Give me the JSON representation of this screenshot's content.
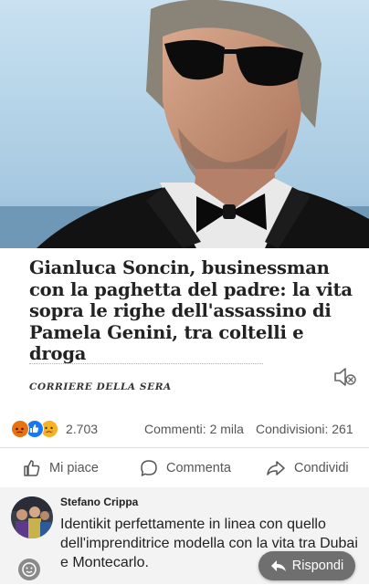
{
  "article": {
    "headline": "Gianluca Soncin, businessman con la paghetta del padre: la vita sopra le righe dell'assassino di Pamela Genini, tra coltelli e droga",
    "source": "CORRIERE DELLA SERA"
  },
  "stats": {
    "reaction_count": "2.703",
    "comments": "Commenti: 2 mila",
    "shares": "Condivisioni: 261"
  },
  "actions": {
    "like": "Mi piace",
    "comment": "Commenta",
    "share": "Condividi"
  },
  "comment": {
    "author": "Stefano Crippa",
    "text": "Identikit perfettamente in linea con quello dell'imprenditrice modella con la vita tra Dubai e Montecarlo.",
    "reply": "Rispondi"
  },
  "colors": {
    "reaction_angry": "#e9710f",
    "reaction_like": "#1877f2",
    "reaction_sad": "#f7b125",
    "reply_bg": "#6f6f6f"
  },
  "icons": [
    "photo-image",
    "mute-icon",
    "angry-reaction-icon",
    "like-reaction-icon",
    "sad-reaction-icon",
    "thumbs-up-icon",
    "comment-bubble-icon",
    "share-arrow-icon",
    "avatar",
    "emoji-icon",
    "reply-arrow-icon"
  ]
}
